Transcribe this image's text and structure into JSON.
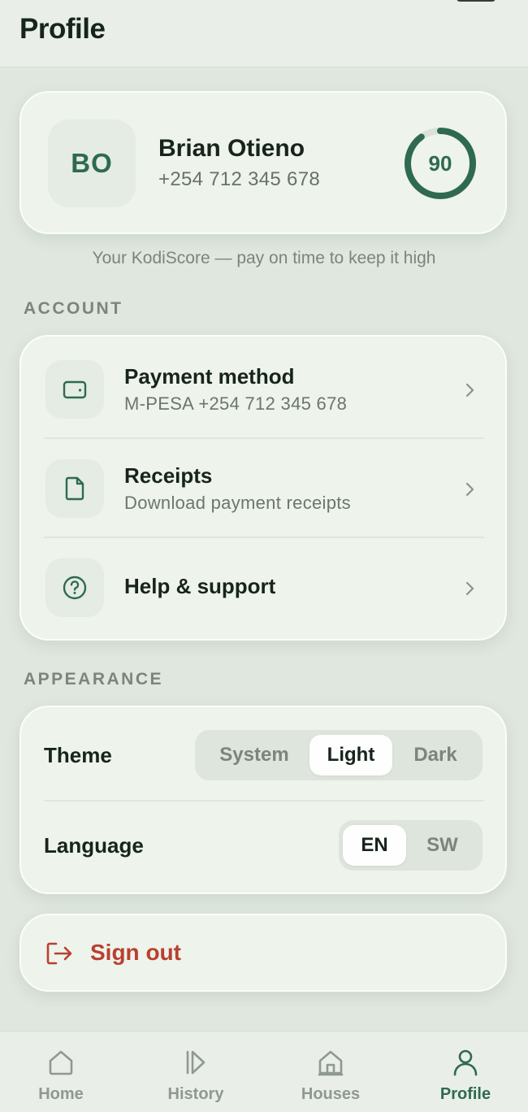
{
  "header": {
    "title": "Profile"
  },
  "profile": {
    "initials": "BO",
    "name": "Brian Otieno",
    "phone": "+254 712 345 678",
    "score": "90",
    "score_fraction": 0.9,
    "score_caption": "Your KodiScore — pay on time to keep it high"
  },
  "account": {
    "section_label": "ACCOUNT",
    "items": [
      {
        "title": "Payment method",
        "subtitle": "M-PESA +254 712 345 678",
        "icon": "wallet-icon"
      },
      {
        "title": "Receipts",
        "subtitle": "Download payment receipts",
        "icon": "document-icon"
      },
      {
        "title": "Help & support",
        "subtitle": "",
        "icon": "help-circle-icon"
      }
    ]
  },
  "appearance": {
    "section_label": "APPEARANCE",
    "theme": {
      "label": "Theme",
      "options": [
        "System",
        "Light",
        "Dark"
      ],
      "selected": "Light"
    },
    "language": {
      "label": "Language",
      "options": [
        "EN",
        "SW"
      ],
      "selected": "EN"
    }
  },
  "signout": {
    "label": "Sign out"
  },
  "tabbar": {
    "tabs": [
      {
        "label": "Home",
        "icon": "home-icon"
      },
      {
        "label": "History",
        "icon": "history-icon"
      },
      {
        "label": "Houses",
        "icon": "house-icon"
      },
      {
        "label": "Profile",
        "icon": "person-icon"
      }
    ],
    "active": "Profile"
  },
  "colors": {
    "accent": "#2f6a4f",
    "danger": "#b9402e",
    "background": "#dfe7de",
    "card": "#eef3ec"
  }
}
